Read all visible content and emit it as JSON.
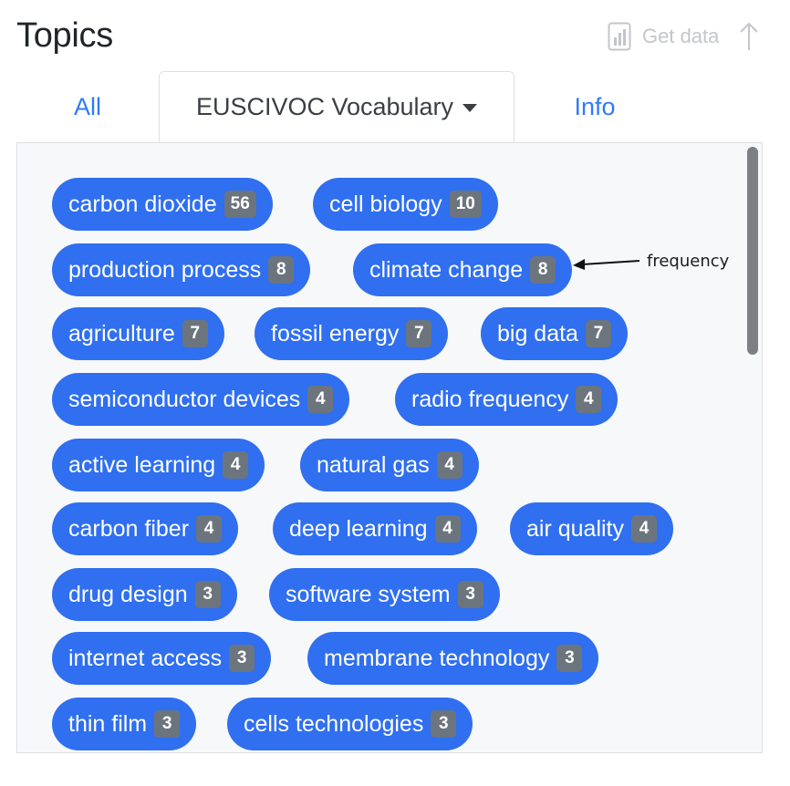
{
  "title": "Topics",
  "get_data": {
    "label": "Get data",
    "icon": "bar-chart-icon",
    "arrow_icon": "arrow-up-icon",
    "color": "#c3c6ca"
  },
  "tabs": {
    "all": "All",
    "vocabulary": "EUSCIVOC Vocabulary",
    "info": "Info"
  },
  "annotation": "frequency",
  "colors": {
    "tag": "#2f6ff0",
    "badge": "#6c757d",
    "tab_link": "#2f7bf5",
    "panel": "#f7f8fa"
  },
  "topics": [
    {
      "label": "carbon dioxide",
      "count": "56"
    },
    {
      "label": "cell biology",
      "count": "10"
    },
    {
      "label": "production process",
      "count": "8"
    },
    {
      "label": "climate change",
      "count": "8"
    },
    {
      "label": "agriculture",
      "count": "7"
    },
    {
      "label": "fossil energy",
      "count": "7"
    },
    {
      "label": "big data",
      "count": "7"
    },
    {
      "label": "semiconductor devices",
      "count": "4"
    },
    {
      "label": "radio frequency",
      "count": "4"
    },
    {
      "label": "active learning",
      "count": "4"
    },
    {
      "label": "natural gas",
      "count": "4"
    },
    {
      "label": "carbon fiber",
      "count": "4"
    },
    {
      "label": "deep learning",
      "count": "4"
    },
    {
      "label": "air quality",
      "count": "4"
    },
    {
      "label": "drug design",
      "count": "3"
    },
    {
      "label": "software system",
      "count": "3"
    },
    {
      "label": "internet access",
      "count": "3"
    },
    {
      "label": "membrane technology",
      "count": "3"
    },
    {
      "label": "thin film",
      "count": "3"
    },
    {
      "label": "cells technologies",
      "count": "3"
    }
  ]
}
